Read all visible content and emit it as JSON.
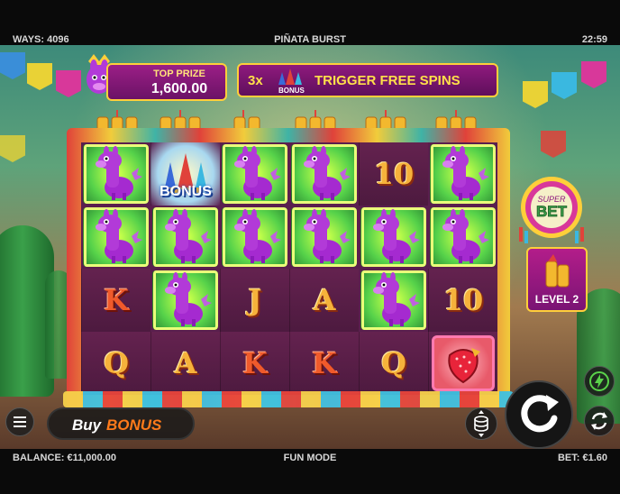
{
  "status_bar": {
    "ways": "WAYS: 4096",
    "title": "PIÑATA BURST",
    "time": "22:59"
  },
  "top_prize": {
    "label": "TOP PRIZE",
    "amount": "1,600.00"
  },
  "free_spins_banner": {
    "multiplier": "3x",
    "bonus_label": "BONUS",
    "text": "TRIGGER FREE SPINS"
  },
  "reels": [
    [
      "llama",
      "bonus",
      "llama",
      "llama",
      "10",
      "llama"
    ],
    [
      "llama",
      "llama",
      "llama",
      "llama",
      "llama",
      "llama"
    ],
    [
      "K",
      "llama",
      "J",
      "A",
      "llama",
      "10"
    ],
    [
      "Q",
      "A",
      "K",
      "K",
      "Q",
      "strawberry"
    ]
  ],
  "reel_bonus_label": "BONUS",
  "super_bet": {
    "top_label": "SUPER",
    "bet_label": "BET",
    "level": "LEVEL 2"
  },
  "controls": {
    "buy_bonus_buy": "Buy",
    "buy_bonus_bonus": "BONUS"
  },
  "bottom_bar": {
    "balance": "BALANCE: €11,000.00",
    "mode": "FUN MODE",
    "bet": "BET: €1.60"
  },
  "colors": {
    "panel_purple": "#8f1a7d",
    "gold_border": "#ffcf3a",
    "highlight_green": "#56d24a",
    "symbol_gold": "#f6b23b",
    "symbol_red": "#f05a2b",
    "buy_bonus_orange": "#ff7a1a"
  },
  "icons": {
    "menu": "hamburger-menu-icon",
    "coins": "coin-stack-icon",
    "spin": "spin-arrow-icon",
    "turbo": "lightning-icon",
    "autoplay": "autoplay-cycle-icon"
  }
}
